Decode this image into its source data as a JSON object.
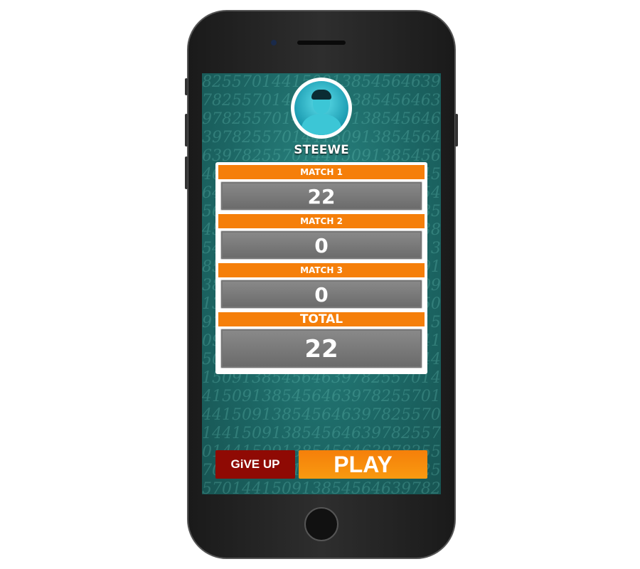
{
  "player": {
    "name": "STEEWE"
  },
  "matches": [
    {
      "label": "MATCH 1",
      "score": "22"
    },
    {
      "label": "MATCH 2",
      "score": "0"
    },
    {
      "label": "MATCH 3",
      "score": "0"
    }
  ],
  "total": {
    "label": "TOTAL",
    "score": "22"
  },
  "buttons": {
    "give_up": "GiVE UP",
    "play": "PLAY"
  },
  "colors": {
    "accent": "#f57f0a",
    "give_up": "#8f0a04",
    "background": "#1c6664"
  }
}
